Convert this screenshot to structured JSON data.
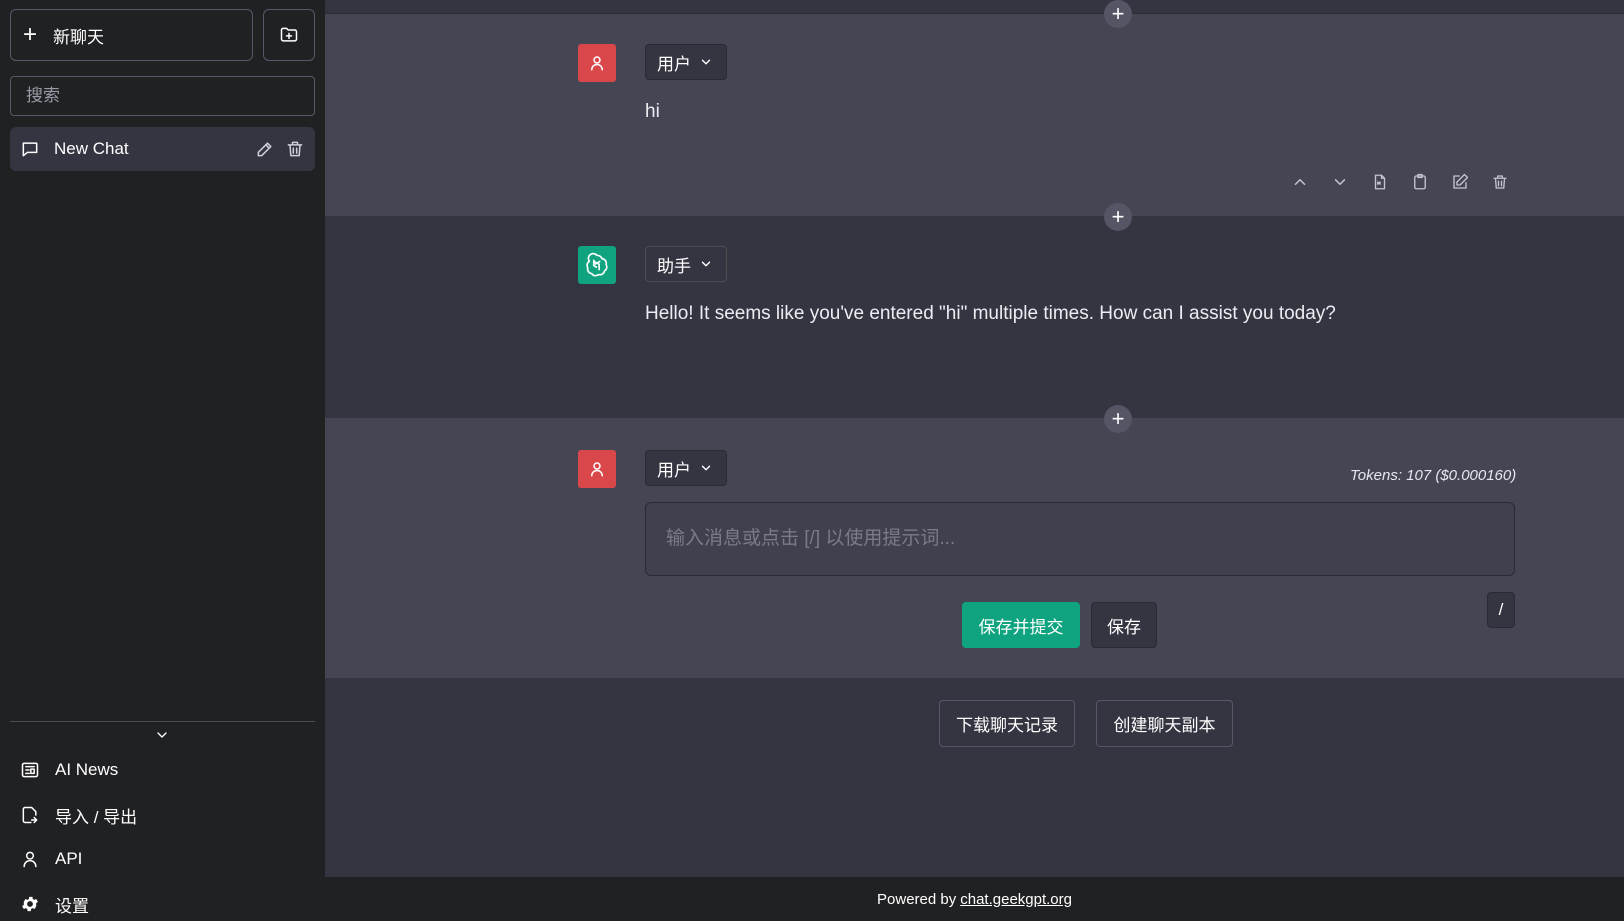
{
  "sidebar": {
    "new_chat_label": "新聊天",
    "search_placeholder": "搜索",
    "chats": [
      {
        "title": "New Chat"
      }
    ],
    "nav": [
      {
        "label": "AI News",
        "icon": "news-icon"
      },
      {
        "label": "导入 / 导出",
        "icon": "file-import-export-icon"
      },
      {
        "label": "API",
        "icon": "user-icon"
      },
      {
        "label": "设置",
        "icon": "gear-icon"
      }
    ]
  },
  "conversation": {
    "messages": [
      {
        "role_label": "用户",
        "text": "hi",
        "avatar": "user-icon",
        "avatar_color": "#d9474b"
      },
      {
        "role_label": "助手",
        "text": "Hello! It seems like you've entered \"hi\" multiple times. How can I assist you today?",
        "avatar": "openai-logo-icon",
        "avatar_color": "#10a37f"
      },
      {
        "role_label": "用户",
        "text": "",
        "avatar": "user-icon",
        "avatar_color": "#d9474b"
      }
    ],
    "tokens": "Tokens: 107 ($0.000160)",
    "input_placeholder": "输入消息或点击 [/] 以使用提示词...",
    "save_submit_label": "保存并提交",
    "save_label": "保存",
    "slash_label": "/",
    "download_label": "下载聊天记录",
    "clone_label": "创建聊天副本"
  },
  "footer": {
    "prefix": "Powered by",
    "link_text": "chat.geekgpt.org"
  },
  "colors": {
    "accent": "#10a37f",
    "user_avatar": "#d9474b",
    "sidebar_bg": "#202123",
    "main_bg": "#343541",
    "user_msg_bg": "#444654"
  }
}
